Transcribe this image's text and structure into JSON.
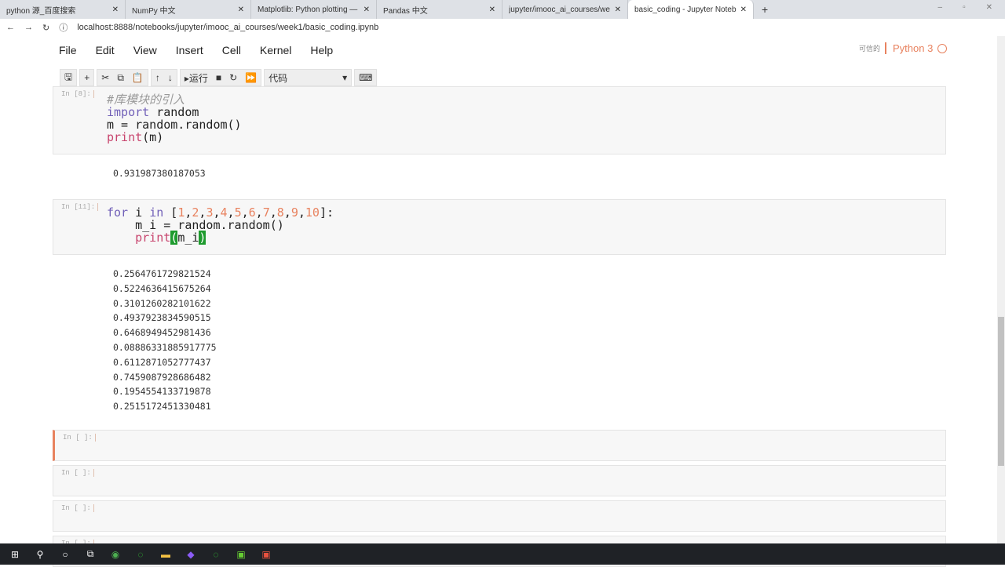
{
  "browser": {
    "tabs": [
      {
        "label": "python 源_百度搜索"
      },
      {
        "label": "NumPy 中文"
      },
      {
        "label": "Matplotlib: Python plotting —"
      },
      {
        "label": "Pandas 中文"
      },
      {
        "label": "jupyter/imooc_ai_courses/we"
      },
      {
        "label": "basic_coding - Jupyter Notebo",
        "active": true
      }
    ],
    "url": "localhost:8888/notebooks/jupyter/imooc_ai_courses/week1/basic_coding.ipynb"
  },
  "menu": [
    "File",
    "Edit",
    "View",
    "Insert",
    "Cell",
    "Kernel",
    "Help"
  ],
  "kernel": {
    "status": "可信的",
    "name": "Python 3"
  },
  "toolbar": {
    "run_label": "运行",
    "cell_type": "代码"
  },
  "cells": [
    {
      "prompt": "In [8]:",
      "comment": "#库模块的引入",
      "kw_import": "import",
      "l1rest": " random",
      "l2": "m = random.random()",
      "print": "print",
      "l3rest": "(m)",
      "output": "0.931987380187053"
    },
    {
      "prompt": "In [11]:",
      "kw_for": "for",
      "i": " i ",
      "kw_in": "in",
      "list_open": " [",
      "nums": [
        "1",
        "2",
        "3",
        "4",
        "5",
        "6",
        "7",
        "8",
        "9",
        "10"
      ],
      "list_close": "]:",
      "l2": "    m_i = random.random()",
      "indent": "    ",
      "print": "print",
      "po": "(",
      "arg": "m_i",
      "pc": ")",
      "outputs": [
        "0.2564761729821524",
        "0.5224636415675264",
        "0.3101260282101622",
        "0.4937923834590515",
        "0.6468949452981436",
        "0.08886331885917775",
        "0.6112871052777437",
        "0.7459087928686482",
        "0.1954554133719878",
        "0.2515172451330481"
      ]
    },
    {
      "prompt": "In [ ]:"
    },
    {
      "prompt": "In [ ]:"
    },
    {
      "prompt": "In [ ]:"
    },
    {
      "prompt": "In [ ]:"
    }
  ]
}
